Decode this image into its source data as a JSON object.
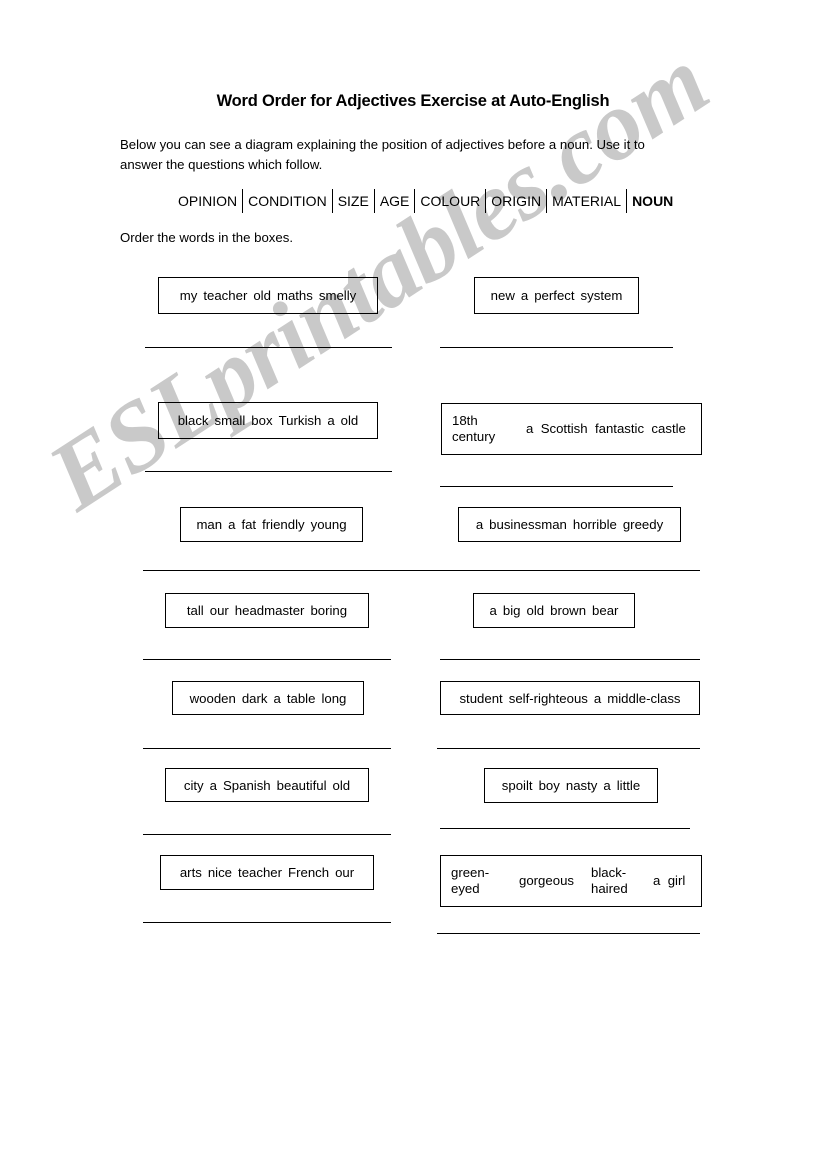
{
  "document": {
    "title": "Word Order for Adjectives Exercise at Auto-English",
    "intro": "Below you can see a diagram explaining the position of adjectives before a noun. Use it to answer the questions which follow.",
    "instruction": "Order the words in the boxes.",
    "watermark": "ESLprintables.com",
    "watermark_color": "#c9c9c9"
  },
  "order_diagram": {
    "cells": [
      "OPINION",
      "CONDITION",
      "SIZE",
      "AGE",
      "COLOUR",
      "ORIGIN",
      "MATERIAL",
      "NOUN"
    ],
    "bold_last": "NOUN"
  },
  "exercises": {
    "left": [
      {
        "words": [
          "my",
          "teacher",
          "old",
          "maths",
          "smelly"
        ]
      },
      {
        "words": [
          "black",
          "small",
          "box",
          "Turkish",
          "a",
          "old"
        ]
      },
      {
        "words": [
          "man",
          "a",
          "fat",
          "friendly",
          "young"
        ]
      },
      {
        "words": [
          "tall",
          "our",
          "headmaster",
          "boring"
        ]
      },
      {
        "words": [
          "wooden",
          "dark",
          "a",
          "table",
          "long"
        ]
      },
      {
        "words": [
          "city",
          "a",
          "Spanish",
          "beautiful",
          "old"
        ]
      },
      {
        "words": [
          "arts",
          "nice",
          "teacher",
          "French",
          "our"
        ]
      }
    ],
    "right": [
      {
        "words": [
          "new",
          "a",
          "perfect",
          "system"
        ]
      },
      {
        "wrapped": true,
        "segments": [
          "18th century",
          "a  Scottish  fantastic  castle"
        ]
      },
      {
        "words": [
          "a",
          "businessman",
          "horrible",
          "greedy"
        ]
      },
      {
        "words": [
          "a",
          "big",
          "old",
          "brown",
          "bear"
        ]
      },
      {
        "words": [
          "student",
          "self-righteous",
          "a",
          "middle-class"
        ]
      },
      {
        "words": [
          "spoilt",
          "boy",
          "nasty",
          "a",
          "little"
        ]
      },
      {
        "wrapped": true,
        "segments": [
          "green- eyed",
          "gorgeous",
          "black- haired",
          "a  girl"
        ]
      }
    ]
  }
}
